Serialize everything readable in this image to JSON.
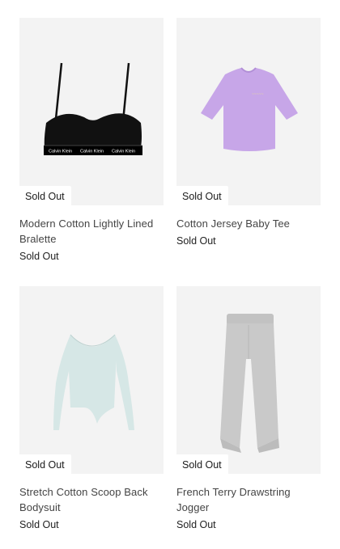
{
  "products": [
    {
      "title": "Modern Cotton Lightly Lined Bralette",
      "badge": "Sold Out",
      "status": "Sold Out",
      "image": "black-bralette-image",
      "brand_text": "Calvin Klein"
    },
    {
      "title": "Cotton Jersey Baby Tee",
      "badge": "Sold Out",
      "status": "Sold Out",
      "image": "lavender-baby-tee-image"
    },
    {
      "title": "Stretch Cotton Scoop Back Bodysuit",
      "badge": "Sold Out",
      "status": "Sold Out",
      "image": "light-blue-bodysuit-image"
    },
    {
      "title": "French Terry Drawstring Jogger",
      "badge": "Sold Out",
      "status": "Sold Out",
      "image": "grey-jogger-image"
    }
  ],
  "colors": {
    "card_bg": "#f3f3f3",
    "bralette": "#111111",
    "tee": "#c7a6e8",
    "bodysuit": "#d6e7e6",
    "jogger": "#c9c9c9"
  }
}
